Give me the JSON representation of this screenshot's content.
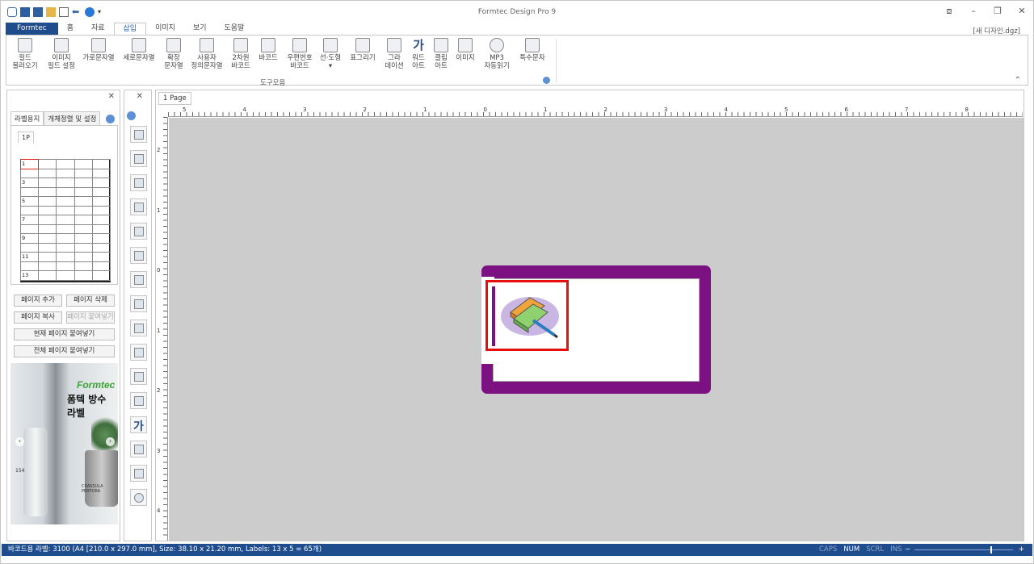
{
  "window": {
    "title": "Formtec Design Pro 9",
    "filename": "[새 디자인.dgz]"
  },
  "ribbon_tabs": [
    "Formtec",
    "홈",
    "자료",
    "삽입",
    "이미지",
    "보기",
    "도움말"
  ],
  "ribbon_buttons": [
    {
      "l1": "필드",
      "l2": "불러오기"
    },
    {
      "l1": "이미지",
      "l2": "필드 설정"
    },
    {
      "l1": "가로문자열",
      "l2": ""
    },
    {
      "l1": "세로문자열",
      "l2": ""
    },
    {
      "l1": "확장",
      "l2": "문자열"
    },
    {
      "l1": "사용자",
      "l2": "정의문자열"
    },
    {
      "l1": "2차원",
      "l2": "바코드"
    },
    {
      "l1": "바코드",
      "l2": ""
    },
    {
      "l1": "우편번호",
      "l2": "바코드"
    },
    {
      "l1": "선·도형",
      "l2": "▾"
    },
    {
      "l1": "표그리기",
      "l2": ""
    },
    {
      "l1": "그라",
      "l2": "데이션"
    },
    {
      "l1": "워드",
      "l2": "아트"
    },
    {
      "l1": "클립",
      "l2": "아트"
    },
    {
      "l1": "이미지",
      "l2": ""
    },
    {
      "l1": "MP3",
      "l2": "자동읽기"
    },
    {
      "l1": "특수문자",
      "l2": ""
    }
  ],
  "ribbon_group_label": "도구모음",
  "left_panel": {
    "tabs": [
      "라벨용지",
      "개체정렬 및 설정"
    ],
    "page_tab": "1P",
    "row_numbers": [
      "1",
      "",
      "3",
      "",
      "5",
      "",
      "7",
      "",
      "9",
      "",
      "11",
      "",
      "13"
    ],
    "buttons": {
      "add_page": "페이지 추가",
      "delete_page": "페이지 삭제",
      "copy_page": "페이지 복사",
      "paste_page": "페이지 붙여넣기",
      "paste_current": "현재 페이지 붙여넣기",
      "paste_all": "전체 페이지 붙여넣기"
    },
    "ad": {
      "logo": "Formtec",
      "headline": "폼텍 방수 라벨",
      "caption": "CRASSULA PERFORA",
      "number": "154"
    }
  },
  "document": {
    "tab": "1 Page",
    "h_ruler": [
      "5",
      "4",
      "3",
      "2",
      "1",
      "0",
      "1",
      "2",
      "3",
      "4",
      "5",
      "6",
      "7",
      "8"
    ],
    "v_ruler": [
      "2",
      "1",
      "0",
      "1",
      "2",
      "3",
      "4"
    ]
  },
  "status": {
    "text": "바코드용 라벨: 3100 (A4 [210.0 x 297.0 mm], Size: 38.10 x 21.20 mm,  Labels: 13 x 5 = 65개)",
    "keys": [
      "CAPS",
      "NUM",
      "SCRL",
      "INS"
    ],
    "zoom_minus": "−",
    "zoom_plus": "+"
  },
  "colors": {
    "accent": "#1e4c8c",
    "label_border": "#7c1181",
    "selection": "#e5100c"
  }
}
